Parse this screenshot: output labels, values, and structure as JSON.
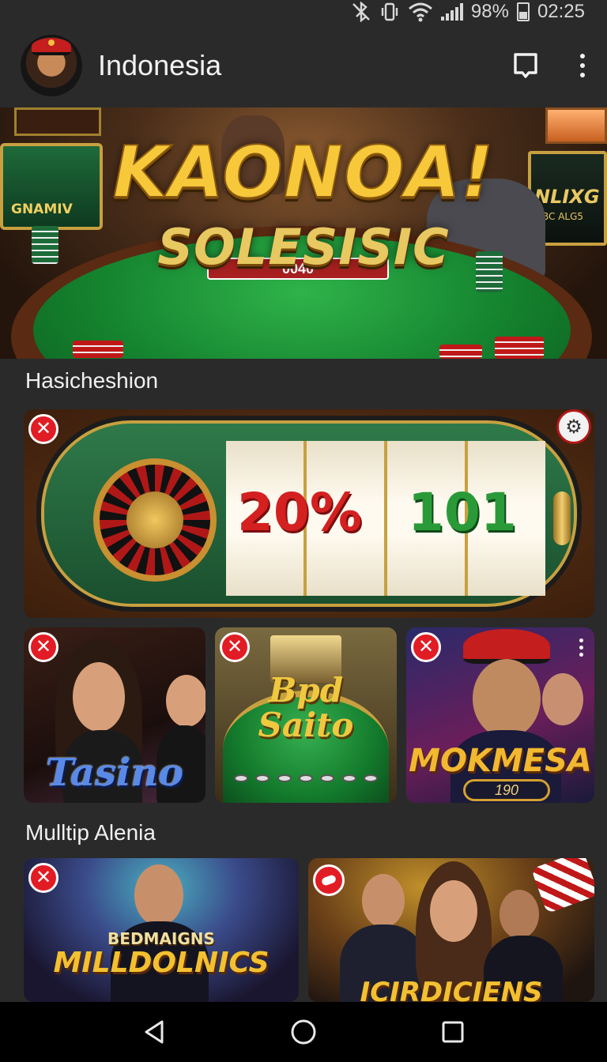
{
  "status_bar": {
    "battery_text": "98%",
    "time": "02:25",
    "icons": [
      "bluetooth-off-icon",
      "vibrate-icon",
      "wifi-icon",
      "signal-icon",
      "battery-icon"
    ]
  },
  "app_bar": {
    "title": "Indonesia",
    "icons": [
      "avatar",
      "bookmark-icon",
      "more-vert-icon"
    ]
  },
  "hero": {
    "title": "KAONOA!",
    "subtitle": "SOLESISIC",
    "sign_text": "NLIXG",
    "sign_subtext": "BC ALG5",
    "machine_text": "GNAMIV",
    "table_text": "0040"
  },
  "sections": [
    {
      "title": "Hasicheshion",
      "featured": {
        "value_left": "20%",
        "value_right": "101"
      },
      "cards": [
        {
          "label": "Tasino"
        },
        {
          "label_line1": "Bpd",
          "label_line2": "Saito"
        },
        {
          "label": "MOKMESA",
          "badge": "190"
        }
      ]
    },
    {
      "title": "Mulltip Alenia",
      "cards": [
        {
          "small_label": "BEDMAIGNS",
          "label": "MILLDOLNICS"
        },
        {
          "label": "ICIRDICIENS"
        }
      ]
    }
  ],
  "nav_bar": {
    "icons": [
      "back-icon",
      "home-icon",
      "recents-icon"
    ]
  },
  "colors": {
    "background": "#2a2a2a",
    "close_badge": "#e21c24",
    "gold_text": "#f2c030"
  }
}
